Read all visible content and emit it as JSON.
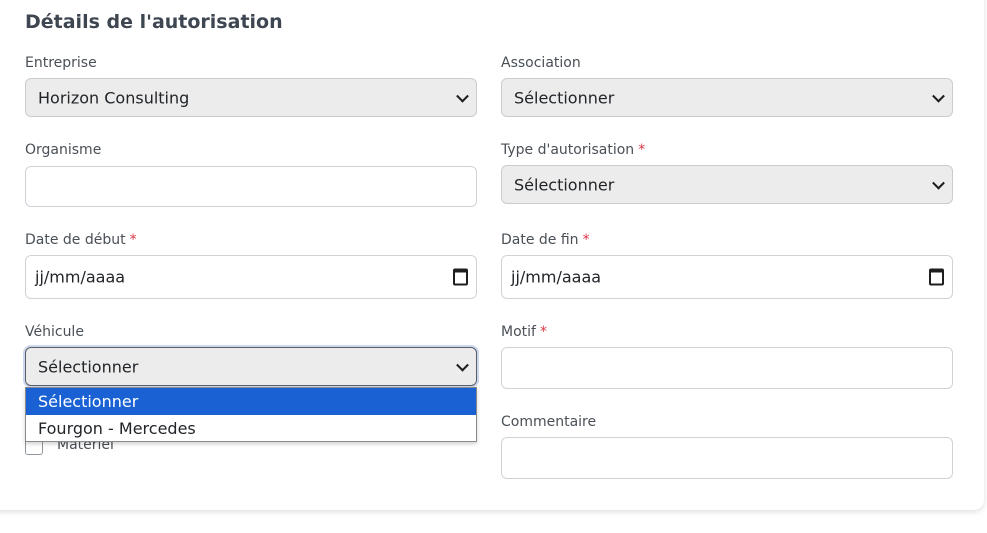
{
  "section": {
    "title": "Détails de l'autorisation"
  },
  "fields": {
    "entreprise": {
      "label": "Entreprise",
      "value": "Horizon Consulting"
    },
    "association": {
      "label": "Association",
      "value": "Sélectionner"
    },
    "organisme": {
      "label": "Organisme",
      "value": ""
    },
    "type_autorisation": {
      "label": "Type d'autorisation",
      "required": "*",
      "value": "Sélectionner"
    },
    "date_debut": {
      "label": "Date de début",
      "required": "*",
      "placeholder": "jj/mm/aaaa"
    },
    "date_fin": {
      "label": "Date de fin",
      "required": "*",
      "placeholder": "jj/mm/aaaa"
    },
    "vehicule": {
      "label": "Véhicule",
      "value": "Sélectionner",
      "options": [
        "Sélectionner",
        "Fourgon - Mercedes"
      ]
    },
    "motif": {
      "label": "Motif",
      "required": "*",
      "value": ""
    },
    "materiel": {
      "label": "Matériel",
      "checked": false
    },
    "commentaire": {
      "label": "Commentaire",
      "value": ""
    }
  },
  "colors": {
    "accent": "#1a62d4",
    "required": "#dc3545"
  }
}
